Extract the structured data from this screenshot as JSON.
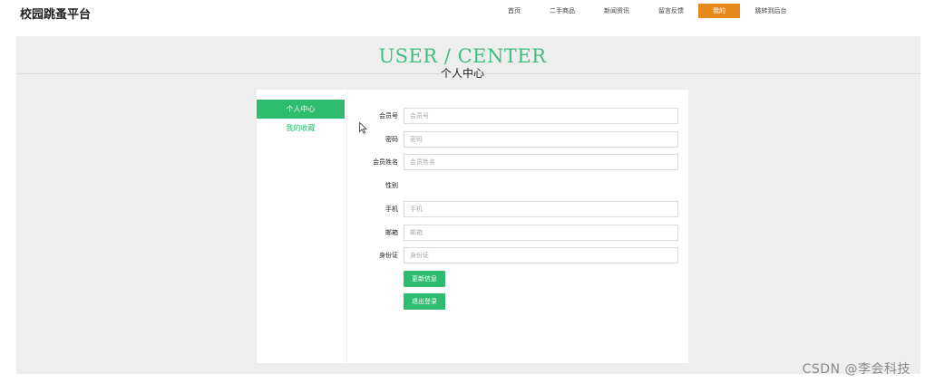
{
  "brand": "校园跳蚤平台",
  "nav": [
    {
      "label": "首页"
    },
    {
      "label": "二手商品"
    },
    {
      "label": "新闻资讯"
    },
    {
      "label": "留言反馈"
    },
    {
      "label": "我的"
    },
    {
      "label": "跳转到后台"
    }
  ],
  "nav_active_index": 4,
  "hero": {
    "title": "USER / CENTER",
    "subtitle": "个人中心"
  },
  "sidebar": {
    "items": [
      {
        "label": "个人中心"
      },
      {
        "label": "我的收藏"
      }
    ]
  },
  "form": {
    "fields": [
      {
        "label": "会员号",
        "placeholder": "会员号"
      },
      {
        "label": "密码",
        "placeholder": "密码"
      },
      {
        "label": "会员姓名",
        "placeholder": "会员姓名"
      },
      {
        "label": "性别"
      },
      {
        "label": "手机",
        "placeholder": "手机"
      },
      {
        "label": "邮箱",
        "placeholder": "邮箱"
      },
      {
        "label": "身份证",
        "placeholder": "身份证"
      }
    ],
    "buttons": {
      "update": "更新信息",
      "logout": "退出登录"
    }
  },
  "watermark": "CSDN @李会科技",
  "colors": {
    "accent": "#2ebc6f",
    "nav_active": "#e8891d",
    "hero_title": "#3fbf7f",
    "band": "#eeeeee"
  }
}
